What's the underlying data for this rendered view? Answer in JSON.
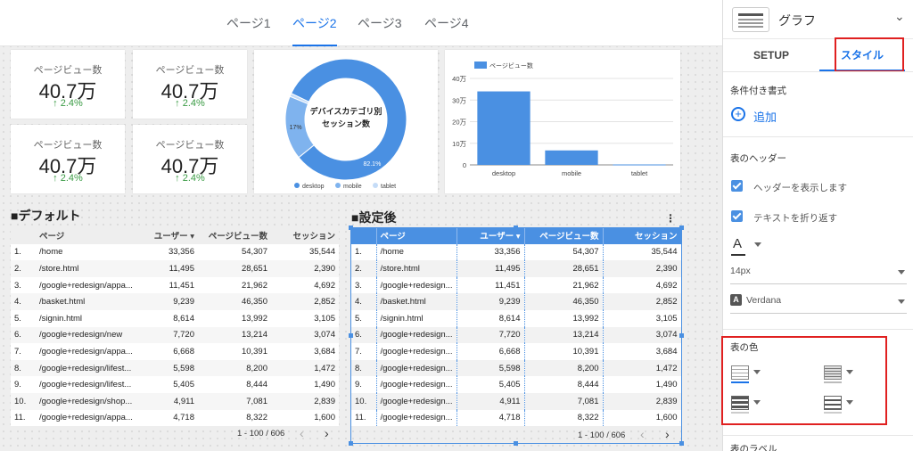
{
  "pages": [
    "ページ1",
    "ページ2",
    "ページ3",
    "ページ4"
  ],
  "kpis": [
    {
      "label": "ページビュー数",
      "value": "40.7万",
      "delta": "2.4%"
    },
    {
      "label": "ページビュー数",
      "value": "40.7万",
      "delta": "2.4%"
    },
    {
      "label": "ページビュー数",
      "value": "40.7万",
      "delta": "2.4%"
    },
    {
      "label": "ページビュー数",
      "value": "40.7万",
      "delta": "2.4%"
    }
  ],
  "donut": {
    "center_text_1": "デバイスカテゴリ別",
    "center_text_2": "セッション数",
    "slices": [
      {
        "name": "desktop",
        "value": 82.1,
        "label": "82.1%",
        "color": "#4a90e2"
      },
      {
        "name": "mobile",
        "value": 17,
        "label": "17%",
        "color": "#7fb3ee"
      },
      {
        "name": "tablet",
        "value": 0.9,
        "label": "",
        "color": "#c5dcf7"
      }
    ]
  },
  "chart_data": {
    "type": "bar",
    "categories": [
      "desktop",
      "mobile",
      "tablet"
    ],
    "series": [
      {
        "name": "ページビュー数",
        "values": [
          340000,
          67000,
          2000
        ]
      }
    ],
    "ylim": [
      0,
      400000
    ],
    "yticks": [
      "0",
      "10万",
      "20万",
      "30万",
      "40万"
    ],
    "color": "#4a90e2",
    "legend": "top-left"
  },
  "table_default": {
    "title": "■デフォルト",
    "headers": [
      "",
      "ページ",
      "ユーザー ▾",
      "ページビュー数",
      "セッション"
    ],
    "rows": [
      [
        "1.",
        "/home",
        "33,356",
        "54,307",
        "35,544"
      ],
      [
        "2.",
        "/store.html",
        "11,495",
        "28,651",
        "2,390"
      ],
      [
        "3.",
        "/google+redesign/appa...",
        "11,451",
        "21,962",
        "4,692"
      ],
      [
        "4.",
        "/basket.html",
        "9,239",
        "46,350",
        "2,852"
      ],
      [
        "5.",
        "/signin.html",
        "8,614",
        "13,992",
        "3,105"
      ],
      [
        "6.",
        "/google+redesign/new",
        "7,720",
        "13,214",
        "3,074"
      ],
      [
        "7.",
        "/google+redesign/appa...",
        "6,668",
        "10,391",
        "3,684"
      ],
      [
        "8.",
        "/google+redesign/lifest...",
        "5,598",
        "8,200",
        "1,472"
      ],
      [
        "9.",
        "/google+redesign/lifest...",
        "5,405",
        "8,444",
        "1,490"
      ],
      [
        "10.",
        "/google+redesign/shop...",
        "4,911",
        "7,081",
        "2,839"
      ],
      [
        "11.",
        "/google+redesign/appa...",
        "4,718",
        "8,322",
        "1,600"
      ]
    ],
    "pager": "1 - 100 / 606"
  },
  "table_custom": {
    "title": "■設定後",
    "headers": [
      "",
      "ページ",
      "ユーザー ▾",
      "ページビュー数",
      "セッション"
    ],
    "rows": [
      [
        "1.",
        "/home",
        "33,356",
        "54,307",
        "35,544"
      ],
      [
        "2.",
        "/store.html",
        "11,495",
        "28,651",
        "2,390"
      ],
      [
        "3.",
        "/google+redesign...",
        "11,451",
        "21,962",
        "4,692"
      ],
      [
        "4.",
        "/basket.html",
        "9,239",
        "46,350",
        "2,852"
      ],
      [
        "5.",
        "/signin.html",
        "8,614",
        "13,992",
        "3,105"
      ],
      [
        "6.",
        "/google+redesign...",
        "7,720",
        "13,214",
        "3,074"
      ],
      [
        "7.",
        "/google+redesign...",
        "6,668",
        "10,391",
        "3,684"
      ],
      [
        "8.",
        "/google+redesign...",
        "5,598",
        "8,200",
        "1,472"
      ],
      [
        "9.",
        "/google+redesign...",
        "5,405",
        "8,444",
        "1,490"
      ],
      [
        "10.",
        "/google+redesign...",
        "4,911",
        "7,081",
        "2,839"
      ],
      [
        "11.",
        "/google+redesign...",
        "4,718",
        "8,322",
        "1,600"
      ]
    ],
    "pager": "1 - 100 / 606"
  },
  "panel": {
    "chart_type": "グラフ",
    "tabs": [
      "SETUP",
      "スタイル"
    ],
    "conditional_format": "条件付き書式",
    "add": "追加",
    "header_section": "表のヘッダー",
    "show_header": "ヘッダーを表示します",
    "wrap_text": "テキストを折り返す",
    "font_size": "14px",
    "font_family": "Verdana",
    "table_color": "表の色",
    "table_label": "表のラベル"
  }
}
